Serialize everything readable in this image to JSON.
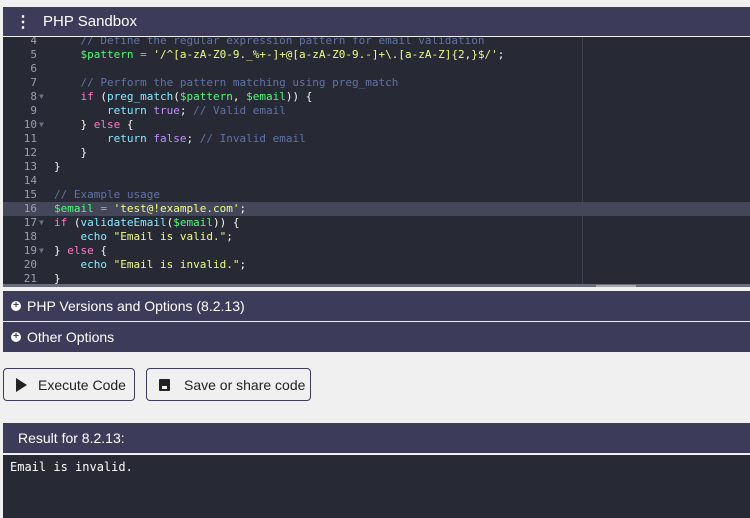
{
  "header": {
    "title": "PHP Sandbox",
    "menu_icon": "kebab-menu-icon"
  },
  "editor": {
    "active_line": 16,
    "lines": [
      {
        "n": "4",
        "fold": false,
        "tokens": [
          [
            "p",
            "    "
          ],
          [
            "c",
            "// Define the regular expression pattern for email validation"
          ]
        ]
      },
      {
        "n": "5",
        "fold": false,
        "tokens": [
          [
            "p",
            "    "
          ],
          [
            "v",
            "$pattern"
          ],
          [
            "p",
            " "
          ],
          [
            "k",
            "="
          ],
          [
            "p",
            " "
          ],
          [
            "s",
            "'/^[a-zA-Z0-9._%+-]+@[a-zA-Z0-9.-]+\\.[a-zA-Z]{2,}$/'"
          ],
          [
            "p",
            ";"
          ]
        ]
      },
      {
        "n": "6",
        "fold": false,
        "tokens": []
      },
      {
        "n": "7",
        "fold": false,
        "tokens": [
          [
            "p",
            "    "
          ],
          [
            "c",
            "// Perform the pattern matching using preg_match"
          ]
        ]
      },
      {
        "n": "8",
        "fold": true,
        "tokens": [
          [
            "p",
            "    "
          ],
          [
            "k",
            "if"
          ],
          [
            "p",
            " ("
          ],
          [
            "f",
            "preg_match"
          ],
          [
            "p",
            "("
          ],
          [
            "v",
            "$pattern"
          ],
          [
            "p",
            ", "
          ],
          [
            "v",
            "$email"
          ],
          [
            "p",
            ")) {"
          ]
        ]
      },
      {
        "n": "9",
        "fold": false,
        "tokens": [
          [
            "p",
            "        "
          ],
          [
            "f",
            "return"
          ],
          [
            "p",
            " "
          ],
          [
            "b",
            "true"
          ],
          [
            "p",
            "; "
          ],
          [
            "c",
            "// Valid email"
          ]
        ]
      },
      {
        "n": "10",
        "fold": true,
        "tokens": [
          [
            "p",
            "    } "
          ],
          [
            "k",
            "else"
          ],
          [
            "p",
            " {"
          ]
        ]
      },
      {
        "n": "11",
        "fold": false,
        "tokens": [
          [
            "p",
            "        "
          ],
          [
            "f",
            "return"
          ],
          [
            "p",
            " "
          ],
          [
            "b",
            "false"
          ],
          [
            "p",
            "; "
          ],
          [
            "c",
            "// Invalid email"
          ]
        ]
      },
      {
        "n": "12",
        "fold": false,
        "tokens": [
          [
            "p",
            "    }"
          ]
        ]
      },
      {
        "n": "13",
        "fold": false,
        "tokens": [
          [
            "p",
            "}"
          ]
        ]
      },
      {
        "n": "14",
        "fold": false,
        "tokens": []
      },
      {
        "n": "15",
        "fold": false,
        "tokens": [
          [
            "c",
            "// Example usage"
          ]
        ]
      },
      {
        "n": "16",
        "fold": false,
        "tokens": [
          [
            "v",
            "$email"
          ],
          [
            "p",
            " "
          ],
          [
            "k",
            "="
          ],
          [
            "p",
            " "
          ],
          [
            "s",
            "'test@!example.com'"
          ],
          [
            "p",
            ";"
          ]
        ]
      },
      {
        "n": "17",
        "fold": true,
        "tokens": [
          [
            "k",
            "if"
          ],
          [
            "p",
            " ("
          ],
          [
            "f",
            "validateEmail"
          ],
          [
            "p",
            "("
          ],
          [
            "v",
            "$email"
          ],
          [
            "p",
            ")) {"
          ]
        ]
      },
      {
        "n": "18",
        "fold": false,
        "tokens": [
          [
            "p",
            "    "
          ],
          [
            "f",
            "echo"
          ],
          [
            "p",
            " "
          ],
          [
            "s",
            "\"Email is valid.\""
          ],
          [
            "p",
            ";"
          ]
        ]
      },
      {
        "n": "19",
        "fold": true,
        "tokens": [
          [
            "p",
            "} "
          ],
          [
            "k",
            "else"
          ],
          [
            "p",
            " {"
          ]
        ]
      },
      {
        "n": "20",
        "fold": false,
        "tokens": [
          [
            "p",
            "    "
          ],
          [
            "f",
            "echo"
          ],
          [
            "p",
            " "
          ],
          [
            "s",
            "\"Email is invalid.\""
          ],
          [
            "p",
            ";"
          ]
        ]
      },
      {
        "n": "21",
        "fold": false,
        "tokens": [
          [
            "p",
            "}"
          ]
        ]
      }
    ]
  },
  "sections": {
    "versions": "PHP Versions and Options (8.2.13)",
    "other": "Other Options"
  },
  "buttons": {
    "execute": "Execute Code",
    "save": "Save or share code"
  },
  "result": {
    "title": "Result for 8.2.13:",
    "output": "Email is invalid."
  }
}
